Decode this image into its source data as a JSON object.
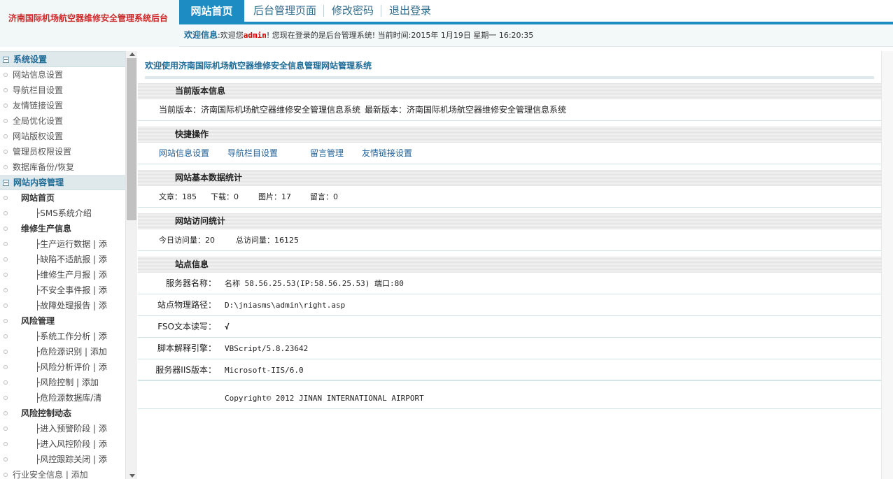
{
  "header": {
    "site_title": "济南国际机场航空器维修安全管理系统后台",
    "nav": [
      {
        "label": "网站首页",
        "active": true
      },
      {
        "label": "后台管理页面",
        "active": false
      },
      {
        "label": "修改密码",
        "active": false
      },
      {
        "label": "退出登录",
        "active": false
      }
    ],
    "welcome_label": "欢迎信息",
    "welcome_pre": ":欢迎您",
    "welcome_user": "admin",
    "welcome_post": "! 您现在登录的是后台管理系统! 当前时间:2015年 1月19日 星期一 16:20:35"
  },
  "sidebar": {
    "group1": {
      "title": "系统设置",
      "items": [
        "网站信息设置",
        "导航栏目设置",
        "友情链接设置",
        "全局优化设置",
        "网站版权设置",
        "管理员权限设置",
        "数据库备份/恢复"
      ]
    },
    "group2": {
      "title": "网站内容管理",
      "rows": [
        {
          "type": "sub",
          "label": "网站首页"
        },
        {
          "type": "leaf",
          "label": "├SMS系统介绍"
        },
        {
          "type": "sub",
          "label": "维修生产信息"
        },
        {
          "type": "leaf",
          "label": "├生产运行数据 | 添"
        },
        {
          "type": "leaf",
          "label": "├缺陷不适航报 | 添"
        },
        {
          "type": "leaf",
          "label": "├维修生产月报 | 添"
        },
        {
          "type": "leaf",
          "label": "├不安全事件报 | 添"
        },
        {
          "type": "leaf",
          "label": "├故障处理报告 | 添"
        },
        {
          "type": "sub",
          "label": "风险管理"
        },
        {
          "type": "leaf",
          "label": "├系统工作分析 | 添"
        },
        {
          "type": "leaf",
          "label": "├危险源识别 | 添加"
        },
        {
          "type": "leaf",
          "label": "├风险分析评价 | 添"
        },
        {
          "type": "leaf",
          "label": "├风险控制 | 添加"
        },
        {
          "type": "leaf",
          "label": "├危险源数据库/清"
        },
        {
          "type": "sub",
          "label": "风险控制动态"
        },
        {
          "type": "leaf",
          "label": "├进入预警阶段 | 添"
        },
        {
          "type": "leaf",
          "label": "├进入风控阶段 | 添"
        },
        {
          "type": "leaf",
          "label": "├风控跟踪关闭 | 添"
        },
        {
          "type": "item",
          "label": "行业安全信息 | 添加"
        }
      ]
    }
  },
  "main": {
    "title": "欢迎使用济南国际机场航空器维修安全信息管理网站管理系统",
    "version": {
      "head": "当前版本信息",
      "current_label": "当前版本：",
      "current_value": "济南国际机场航空器维修安全管理信息系统",
      "latest_label": "最新版本：",
      "latest_value": "济南国际机场航空器维修安全管理信息系统"
    },
    "quick": {
      "head": "快捷操作",
      "links": [
        "网站信息设置",
        "导航栏目设置",
        "留言管理",
        "友情链接设置"
      ]
    },
    "stats": {
      "head": "网站基本数据统计",
      "articles_label": "文章：",
      "articles": "185",
      "downloads_label": "下载：",
      "downloads": "0",
      "images_label": "图片：",
      "images": "17",
      "messages_label": "留言：",
      "messages": "0"
    },
    "visits": {
      "head": "网站访问统计",
      "today_label": "今日访问量：",
      "today": "20",
      "total_label": "总访问量：",
      "total": "16125"
    },
    "site": {
      "head": "站点信息",
      "rows": [
        {
          "label": "服务器名称：",
          "value": "名称 58.56.25.53(IP:58.56.25.53) 端口:80"
        },
        {
          "label": "站点物理路径：",
          "value": "D:\\jniasms\\admin\\right.asp"
        },
        {
          "label": "FSO文本读写：",
          "value": "√"
        },
        {
          "label": "脚本解释引擎：",
          "value": "VBScript/5.8.23642"
        },
        {
          "label": "服务器IIS版本：",
          "value": "Microsoft-IIS/6.0"
        }
      ]
    },
    "copyright": "Copyright© 2012 JINAN INTERNATIONAL AIRPORT"
  }
}
